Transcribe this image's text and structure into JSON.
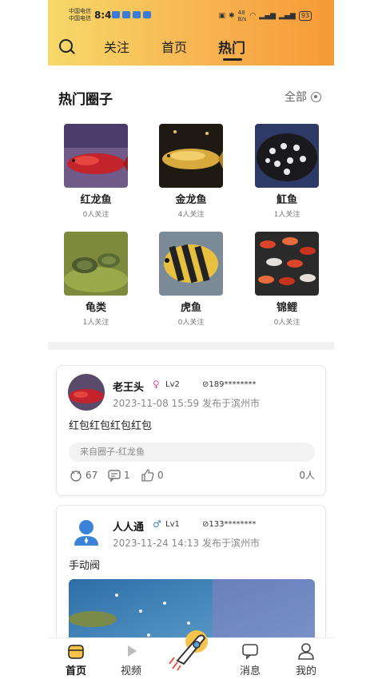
{
  "status_bar": {
    "carrier_1": "中国电信",
    "carrier_2": "中国电信",
    "time": "8:45",
    "net_speed_value": "48",
    "net_speed_unit": "B/s",
    "battery": "93"
  },
  "nav": {
    "tabs": [
      {
        "label": "关注"
      },
      {
        "label": "首页"
      },
      {
        "label": "热门"
      }
    ],
    "active_tab": "热门"
  },
  "circles": {
    "title": "热门圈子",
    "all_label": "全部",
    "items": [
      {
        "name": "红龙鱼",
        "followers": "0人关注"
      },
      {
        "name": "金龙鱼",
        "followers": "4人关注"
      },
      {
        "name": "魟鱼",
        "followers": "1人关注"
      },
      {
        "name": "龟类",
        "followers": "1人关注"
      },
      {
        "name": "虎鱼",
        "followers": "0人关注"
      },
      {
        "name": "锦鲤",
        "followers": "0人关注"
      }
    ]
  },
  "posts": [
    {
      "username": "老王头",
      "gender_icon": "female-icon",
      "level": "Lv2",
      "phone": "189********",
      "time": "2023-11-08 15:59",
      "location": "发布于滨州市",
      "content": "红包红包红包红包",
      "source": "来自圈子-红龙鱼",
      "likes": "67",
      "comments": "1",
      "thumbs": "0",
      "viewers": "0人"
    },
    {
      "username": "人人通",
      "gender_icon": "male-icon",
      "level": "Lv1",
      "phone": "133********",
      "time": "2023-11-24 14:13",
      "location": "发布于滨州市",
      "content": "手动阀"
    }
  ],
  "bottom_nav": {
    "items": [
      {
        "label": "首页"
      },
      {
        "label": "视频"
      },
      {
        "label": "消息"
      },
      {
        "label": "我的"
      }
    ]
  },
  "colors": {
    "header_gradient_start": "#f7d96a",
    "header_gradient_end": "#f59a38",
    "female": "#e0559b",
    "male": "#3b82d9"
  }
}
